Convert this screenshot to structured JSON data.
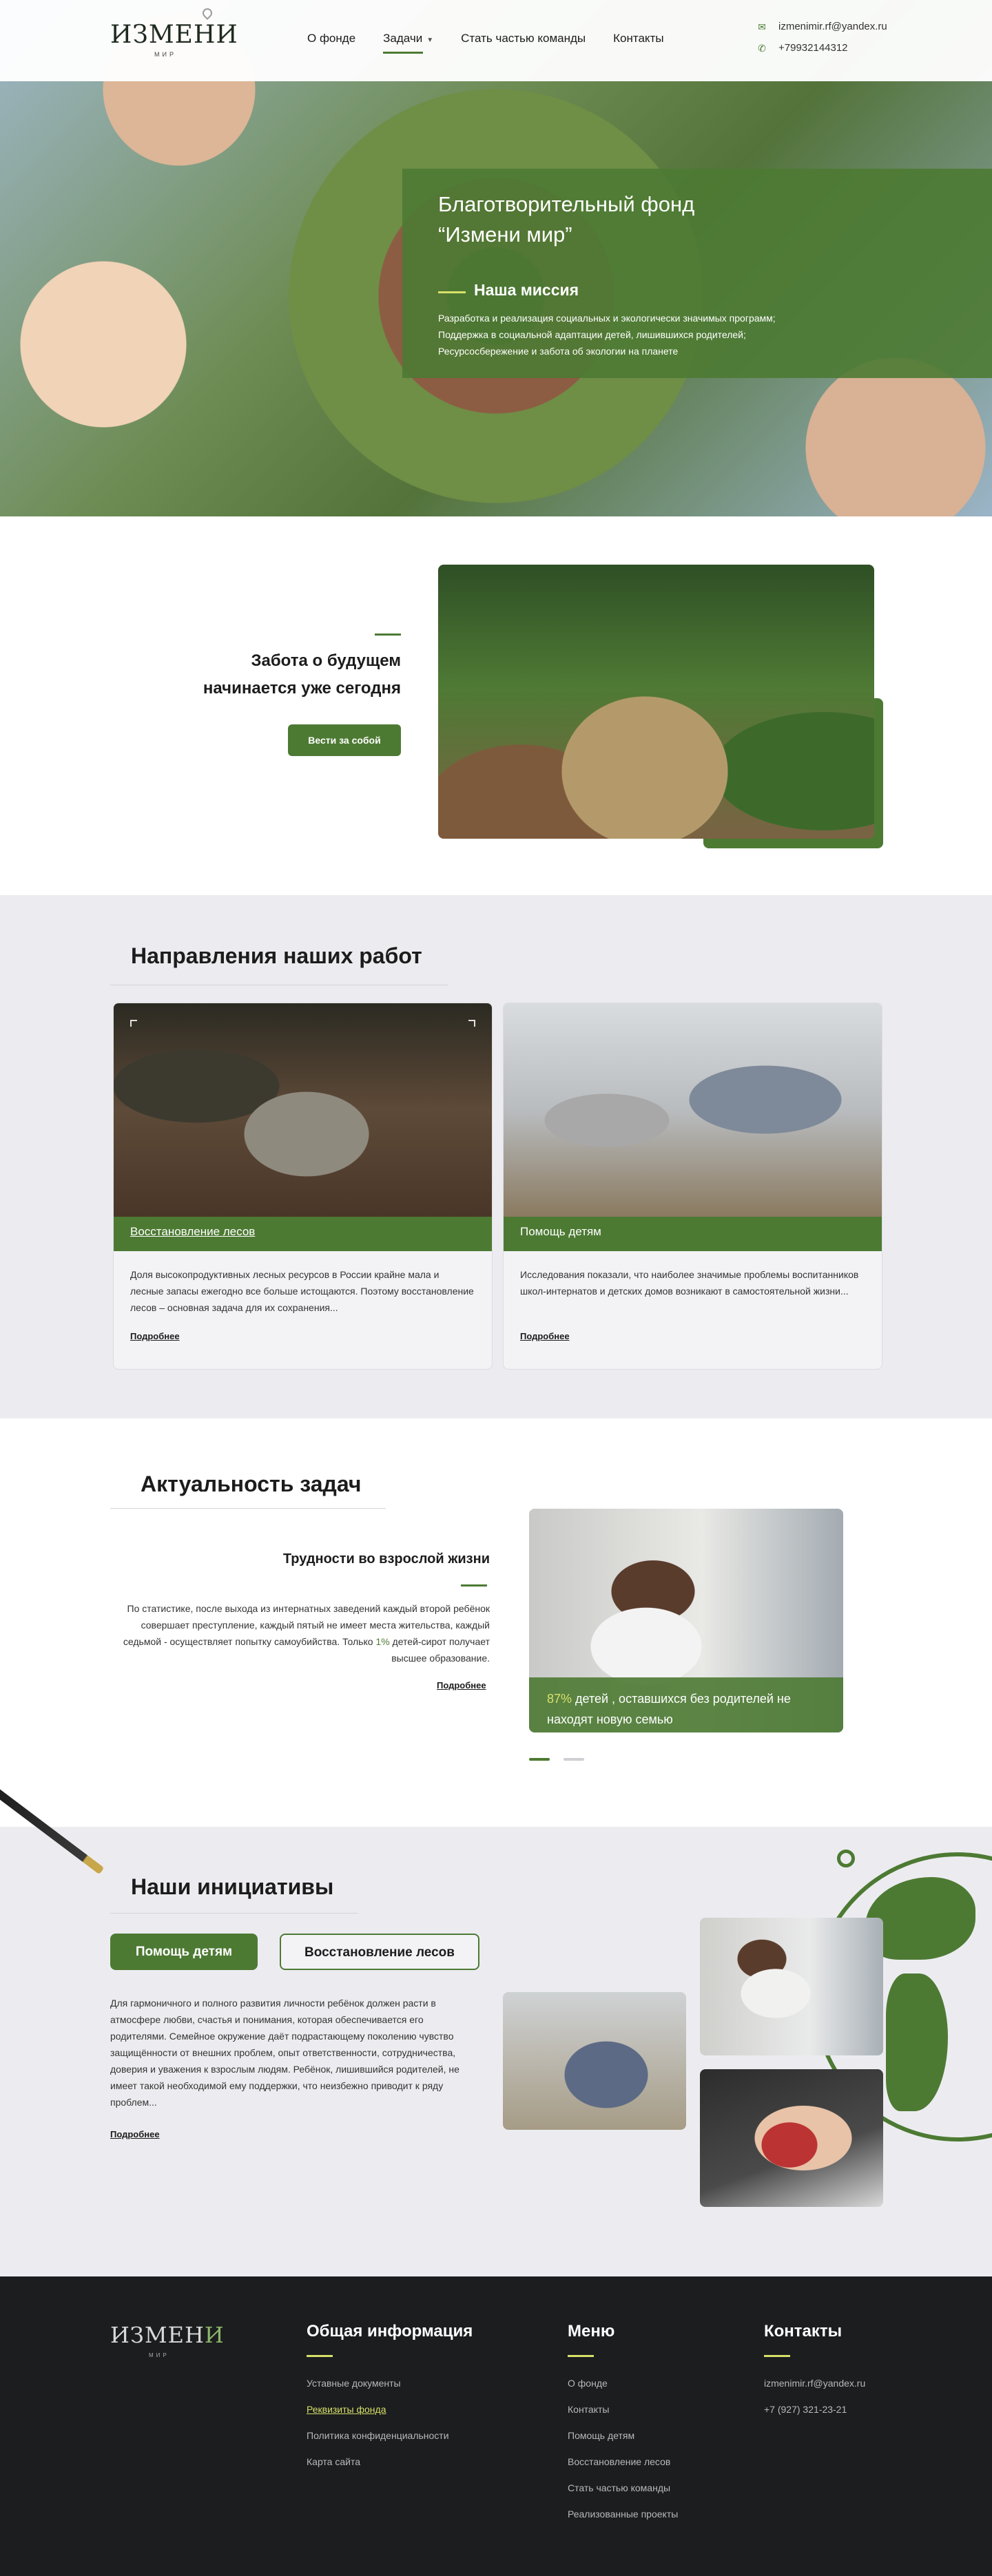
{
  "header": {
    "logo_word": "ИЗМЕН",
    "logo_accent": "И",
    "logo_sub": "МИР",
    "nav": [
      {
        "label": "О фонде"
      },
      {
        "label": "Задачи"
      },
      {
        "label": "Стать частью команды"
      },
      {
        "label": "Контакты"
      }
    ],
    "email": "izmenimir.rf@yandex.ru",
    "phone": "+79932144312"
  },
  "hero": {
    "title_line1": "Благотворительный фонд",
    "title_line2": "“Измени мир”",
    "mission_heading": "Наша миссия",
    "mission_items": [
      "Разработка и реализация социальных и экологически значимых программ;",
      "Поддержка в социальной адаптации детей, лишившихся родителей;",
      "Ресурсосбережение и забота об экологии на планете"
    ]
  },
  "care": {
    "title_line1": "Забота о будущем",
    "title_line2": "начинается уже сегодня",
    "button": "Вести за собой"
  },
  "directions": {
    "title": "Направления наших работ",
    "cards": [
      {
        "label": "Восстановление лесов",
        "text": "Доля высокопродуктивных лесных ресурсов в России крайне мала и лесные запасы ежегодно все больше истощаются. Поэтому восстановление лесов – основная задача для их сохранения...",
        "more": "Подробнее"
      },
      {
        "label": "Помощь детям",
        "text": "Исследования показали, что наиболее значимые  проблемы воспитанников школ-интернатов и детских домов возникают в самостоятельной жизни...",
        "more": "Подробнее"
      }
    ]
  },
  "relevance": {
    "title": "Актуальность задач",
    "subtitle": "Трудности во взрослой жизни",
    "text_before": "По статистике, после выхода из интернатных заведений каждый второй ребёнок совершает преступление, каждый пятый не имеет места жительства, каждый седьмой - осуществляет попытку самоубийства. Только ",
    "text_highlight": "1%",
    "text_after": " детей-сирот получает высшее образование.",
    "more": "Подробнее",
    "caption_highlight": "87%",
    "caption_rest": " детей , оставшихся без родителей не находят новую семью"
  },
  "initiatives": {
    "title": "Наши инициативы",
    "tab_active": "Помощь детям",
    "tab_inactive": "Восстановление лесов",
    "text": "Для гармоничного и полного развития личности ребёнок должен расти в атмосфере любви, счастья и понимания, которая обеспечивается его родителями. Семейное окружение даёт подрастающему поколению чувство защищённости от внешних проблем, опыт ответственности, сотрудничества, доверия и уважения к взрослым людям. Ребёнок, лишившийся родителей, не имеет такой необходимой ему поддержки, что неизбежно приводит к ряду проблем...",
    "more": "Подробнее"
  },
  "footer": {
    "logo_word": "ИЗМЕН",
    "logo_accent": "И",
    "logo_sub": "МИР",
    "general": {
      "title": "Общая информация",
      "links": [
        "Уставные документы",
        "Реквизиты фонда",
        "Политика конфиденциальности",
        "Карта сайта"
      ]
    },
    "menu": {
      "title": "Меню",
      "links": [
        "О фонде",
        "Контакты",
        "Помощь детям",
        "Восстановление лесов",
        "Стать частью команды",
        "Реализованные проекты"
      ]
    },
    "contacts": {
      "title": "Контакты",
      "email": "izmenimir.rf@yandex.ru",
      "phone": "+7 (927) 321-23-21"
    }
  },
  "colors": {
    "brand_green": "#4d7a33",
    "accent_yellow": "#d8e06a",
    "footer_bg": "#1b1d1e",
    "section_bg": "#ececf0"
  },
  "icons": [
    "mail-icon",
    "phone-icon",
    "caret-down-icon",
    "map-pin-icon"
  ]
}
